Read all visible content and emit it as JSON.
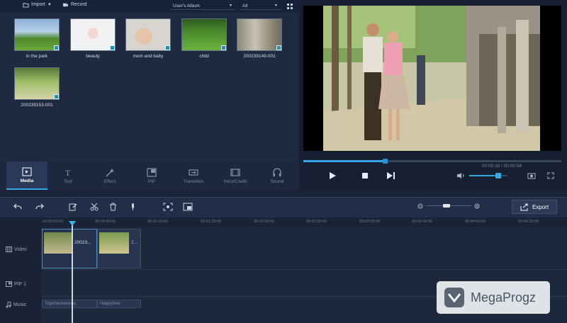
{
  "toolbar": {
    "import_label": "Import",
    "record_label": "Record",
    "album_select": "User's Album",
    "filter_select": "All"
  },
  "media": [
    {
      "label": "in the park"
    },
    {
      "label": "beauty"
    },
    {
      "label": "mom and baby"
    },
    {
      "label": "child"
    },
    {
      "label": "200239149-001"
    },
    {
      "label": "200239153-001"
    }
  ],
  "tools": [
    {
      "label": "Media",
      "icon": "media-icon",
      "active": true
    },
    {
      "label": "Text",
      "icon": "text-icon"
    },
    {
      "label": "Effect",
      "icon": "effect-icon"
    },
    {
      "label": "PIP",
      "icon": "pip-icon"
    },
    {
      "label": "Transition",
      "icon": "transition-icon"
    },
    {
      "label": "Intro/Credit",
      "icon": "intro-credit-icon"
    },
    {
      "label": "Sound",
      "icon": "sound-icon"
    }
  ],
  "preview": {
    "timecode": "00:00:18 / 00:00:58",
    "progress": 0.32,
    "volume": 0.75
  },
  "timeline": {
    "ruler": [
      "00:00:00:00",
      "00:00:30:00",
      "00:01:00:00",
      "00:01:30:00",
      "00:02:00:00",
      "00:02:30:00",
      "00:03:00:00",
      "00:03:30:00",
      "00:04:00:00",
      "00:04:30:00"
    ],
    "tracks": {
      "video": "Video",
      "pip": "PIP 1",
      "music": "Music"
    },
    "clips": [
      {
        "label": "20023..."
      },
      {
        "label": "2..."
      }
    ],
    "audio_clips": [
      {
        "label": "Togethereenewu"
      },
      {
        "label": "Happytime"
      }
    ]
  },
  "export_label": "Export",
  "watermark": "MegaProgz",
  "colors": {
    "accent": "#35a7e6",
    "panel": "#1f2a40",
    "background": "#1b2336"
  }
}
